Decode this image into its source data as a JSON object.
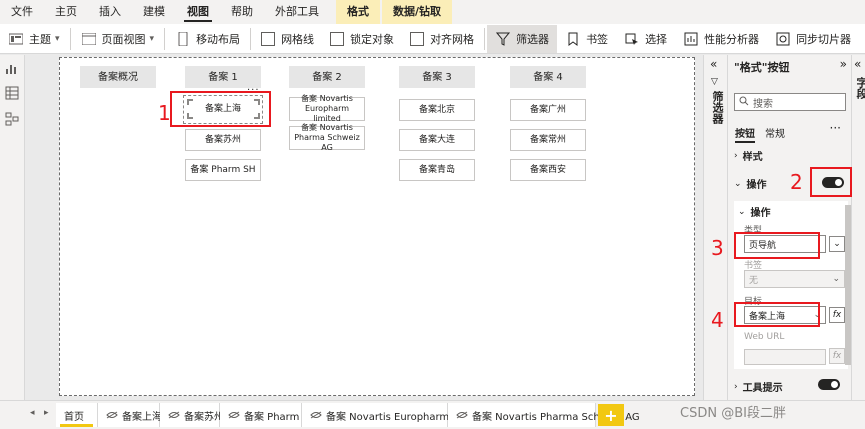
{
  "menu": [
    "文件",
    "主页",
    "插入",
    "建模",
    "视图",
    "帮助",
    "外部工具",
    "格式",
    "数据/钻取"
  ],
  "ribbon": {
    "theme": "主题",
    "page_view": "页面视图",
    "mobile_layout": "移动布局",
    "gridlines": "网格线",
    "lock_objects": "锁定对象",
    "snap_grid": "对齐网格",
    "filters": "筛选器",
    "bookmarks": "书签",
    "selection": "选择",
    "performance": "性能分析器",
    "sync_slicers": "同步切片器"
  },
  "canvas": {
    "headers": [
      "备案概况",
      "备案 1",
      "备案 2",
      "备案 3",
      "备案 4"
    ],
    "col1": [
      "备案上海",
      "备案苏州",
      "备案 Pharm SH"
    ],
    "col2": [
      "备案 Novartis Europharm limited",
      "备案 Novartis Pharma Schweiz AG"
    ],
    "col3": [
      "备案北京",
      "备案大连",
      "备案青岛"
    ],
    "col4": [
      "备案广州",
      "备案常州",
      "备案西安"
    ],
    "more": "...",
    "markers": [
      "1",
      "2",
      "3",
      "4"
    ]
  },
  "filters_pane": {
    "title": "筛选器"
  },
  "fields_pane": {
    "title": "字段"
  },
  "format_pane": {
    "title": "\"格式\"按钮",
    "search_placeholder": "搜索",
    "tabs": [
      "按钮",
      "常规"
    ],
    "more": "···",
    "style": "样式",
    "action_section": "操作",
    "action_sub": "操作",
    "type_label": "类型",
    "type_value": "页导航",
    "bookmark_label": "书签",
    "bookmark_value": "无",
    "target_label": "目标",
    "target_value": "备案上海",
    "fx": "fx",
    "web_url_label": "Web URL",
    "tooltip": "工具提示",
    "action_on": true,
    "tooltip_on": true
  },
  "page_tabs": [
    "首页",
    "备案上海",
    "备案苏州",
    "备案 Pharm SH",
    "备案 Novartis Europharm limited",
    "备案 Novartis Pharma Schweiz AG"
  ],
  "add_tab": "+",
  "watermark": "CSDN @BI段二胖",
  "colors": {
    "accent": "#f2c811",
    "annotation": "#e8191f",
    "context_tab": "#fbeeb8"
  }
}
